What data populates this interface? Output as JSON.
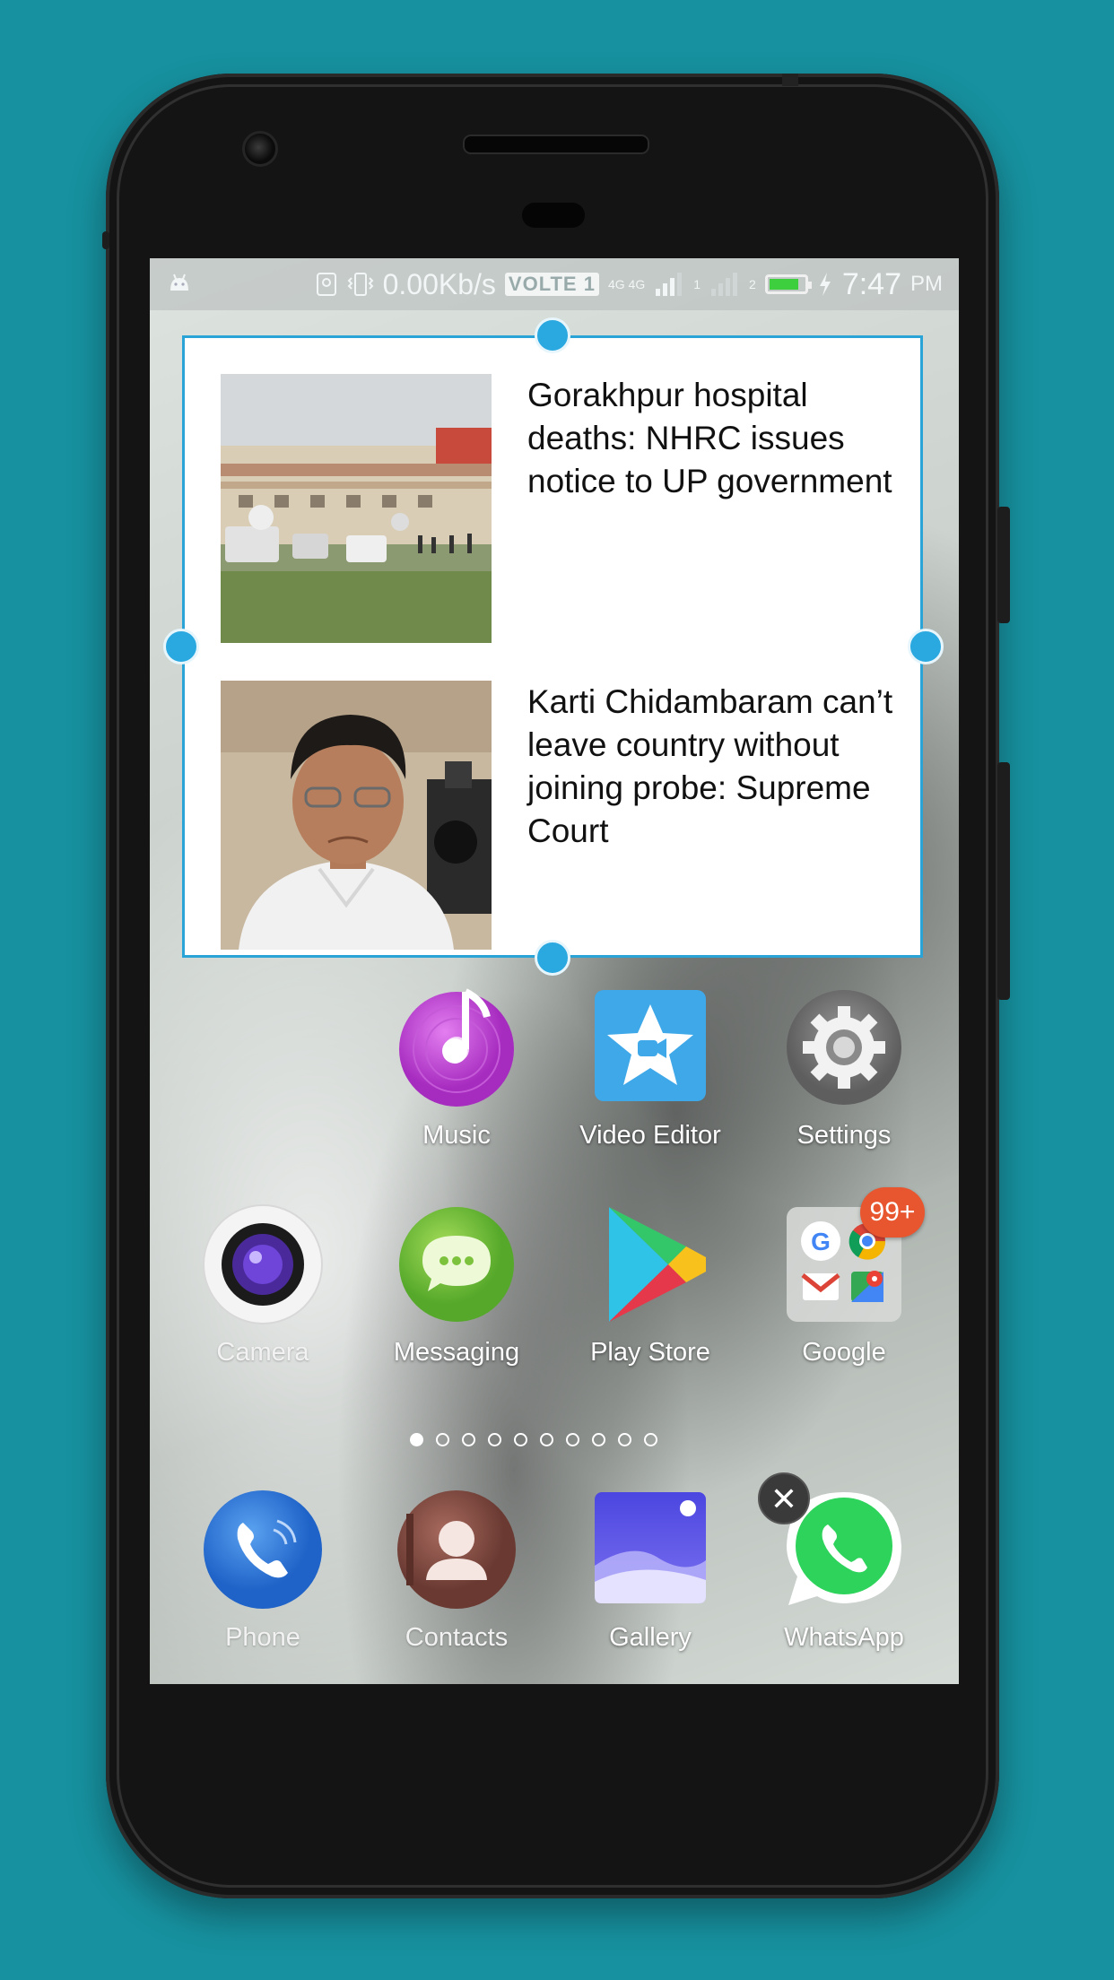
{
  "status_bar": {
    "network_speed": "0.00Kb/s",
    "volte": "VOLTE 1",
    "net_type": "4G 4G",
    "sim1": "1",
    "sim2": "2",
    "time": "7:47",
    "ampm": "PM",
    "battery_level": 0.85
  },
  "news_widget": {
    "items": [
      {
        "title": "Gorakhpur hospital deaths: NHRC issues notice to UP government"
      },
      {
        "title": "Karti Chidambaram can’t leave country without joining probe: Supreme Court"
      }
    ]
  },
  "apps_row1": [
    {
      "label": "Music",
      "icon": "music-icon"
    },
    {
      "label": "Video Editor",
      "icon": "video-editor-icon"
    },
    {
      "label": "Settings",
      "icon": "gear-icon"
    }
  ],
  "apps_row2": [
    {
      "label": "Camera",
      "icon": "camera-icon"
    },
    {
      "label": "Messaging",
      "icon": "messaging-icon"
    },
    {
      "label": "Play Store",
      "icon": "play-store-icon"
    },
    {
      "label": "Google",
      "icon": "google-folder-icon",
      "badge": "99+"
    }
  ],
  "page_indicator": {
    "count": 10,
    "active_index": 0
  },
  "dock": [
    {
      "label": "Phone",
      "icon": "phone-icon"
    },
    {
      "label": "Contacts",
      "icon": "contacts-icon"
    },
    {
      "label": "Gallery",
      "icon": "gallery-icon"
    },
    {
      "label": "WhatsApp",
      "icon": "whatsapp-icon",
      "removable": true
    }
  ],
  "colors": {
    "background": "#17919f",
    "widget_border": "#2aa3d6",
    "handle": "#2aa8e0",
    "badge": "#e8562f"
  }
}
